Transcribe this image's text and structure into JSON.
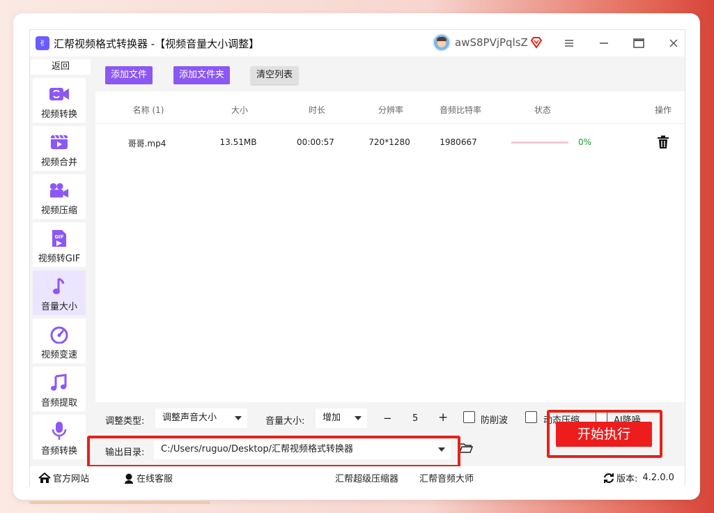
{
  "app": {
    "title": "汇帮视频格式转换器  -【视频音量大小调整】",
    "logo_text": "✌",
    "user_name": "awS8PVjPqlsZ"
  },
  "sidebar": {
    "back_label": "返回",
    "items": [
      {
        "label": "视频转换",
        "icon": "video-convert-icon"
      },
      {
        "label": "视频合并",
        "icon": "video-merge-icon"
      },
      {
        "label": "视频压缩",
        "icon": "video-compress-icon"
      },
      {
        "label": "视频转GIF",
        "icon": "gif-icon"
      },
      {
        "label": "音量大小",
        "icon": "music-note-icon",
        "active": true
      },
      {
        "label": "视频变速",
        "icon": "speedometer-icon"
      },
      {
        "label": "音频提取",
        "icon": "audio-extract-icon"
      },
      {
        "label": "音频转换",
        "icon": "microphone-icon"
      }
    ]
  },
  "toolbar": {
    "add_file": "添加文件",
    "add_folder": "添加文件夹",
    "clear_list": "清空列表"
  },
  "table": {
    "headers": {
      "name": "名称 (1)",
      "size": "大小",
      "duration": "时长",
      "resolution": "分辨率",
      "bitrate": "音频比特率",
      "status": "状态",
      "action": "操作"
    },
    "rows": [
      {
        "name": "哥哥.mp4",
        "size": "13.51MB",
        "duration": "00:00:57",
        "resolution": "720*1280",
        "bitrate": "1980667",
        "progress_percent": 0,
        "progress_text": "0%"
      }
    ]
  },
  "controls": {
    "adjust_type_label": "调整类型:",
    "adjust_type_value": "调整声音大小",
    "volume_label": "音量大小:",
    "volume_mode": "增加",
    "minus": "−",
    "volume_value": "5",
    "plus": "+",
    "anti_clip_label": "防削波",
    "dynamic_compress_label": "动态压缩",
    "ai_denoise_label": "AI降噪",
    "output_label": "输出目录:",
    "output_path": "C:/Users/ruguo/Desktop/汇帮视频格式转换器",
    "start_button": "开始执行"
  },
  "footer": {
    "website": "官方网站",
    "support": "在线客服",
    "link1": "汇帮超级压缩器",
    "link2": "汇帮音频大师",
    "version_label": "版本:",
    "version_value": "4.2.0.0"
  },
  "colors": {
    "accent": "#8b57f5",
    "danger": "#ee1d1d",
    "progress": "#e2207a",
    "success": "#1a9a2a"
  }
}
